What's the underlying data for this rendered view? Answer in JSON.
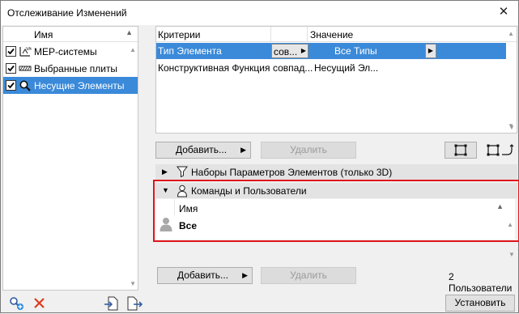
{
  "window": {
    "title": "Отслеживание Изменений",
    "close_glyph": "✕"
  },
  "left_panel": {
    "header": "Имя",
    "items": [
      {
        "label": "MEP-системы",
        "checked": true,
        "selected": false,
        "icon": "mep-icon"
      },
      {
        "label": "Выбранные плиты",
        "checked": true,
        "selected": false,
        "icon": "slab-icon"
      },
      {
        "label": "Несущие Элементы",
        "checked": true,
        "selected": true,
        "icon": "structural-search-icon"
      }
    ]
  },
  "criteria_table": {
    "headers": {
      "criteria": "Критерии",
      "value": "Значение"
    },
    "rows": [
      {
        "criterion": "Тип Элемента",
        "operator": "сов...",
        "value": "Все Типы",
        "selected": true
      },
      {
        "criterion": "Конструктивная Функция",
        "operator": "совпад...",
        "value": "Несущий Эл...",
        "selected": false
      }
    ]
  },
  "criteria_buttons": {
    "add": "Добавить...",
    "remove": "Удалить"
  },
  "sections": {
    "param_sets": "Наборы Параметров Элементов (только 3D)",
    "commands_users": "Команды и Пользователи"
  },
  "users_table": {
    "header": "Имя",
    "rows": [
      {
        "name": "Все"
      }
    ]
  },
  "users_buttons": {
    "add": "Добавить...",
    "remove": "Удалить"
  },
  "user_count": "2 Пользователи",
  "apply_button": "Установить",
  "colors": {
    "selection": "#3b8ad9",
    "highlight_frame": "#e0151b",
    "delete": "#e03a1e"
  }
}
